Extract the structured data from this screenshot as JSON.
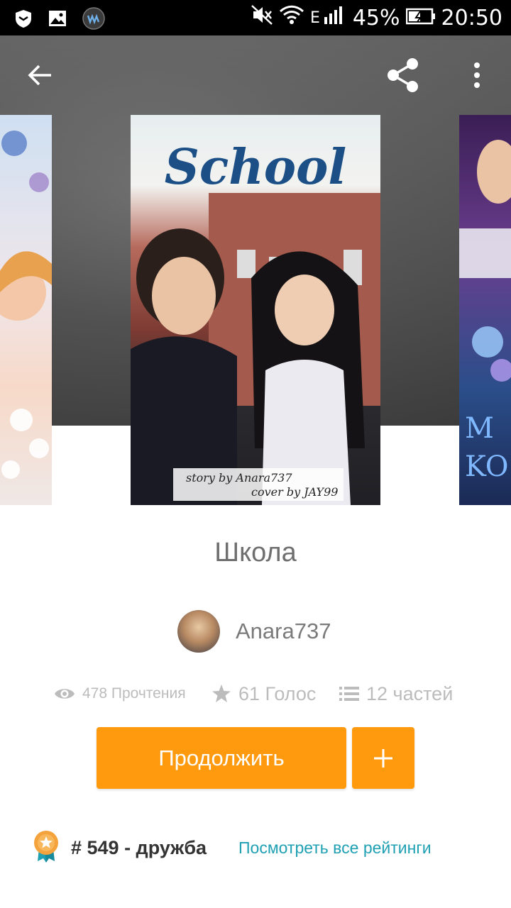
{
  "status_bar": {
    "battery": "45%",
    "time": "20:50"
  },
  "hero": {
    "center_cover": {
      "title": "School",
      "credit_story": "story by Anara737",
      "credit_cover": "cover by JAY99"
    },
    "right_cover_text": "M\nKO"
  },
  "story": {
    "title": "Школа",
    "author": "Anara737",
    "reads": "478 Прочтения",
    "votes": "61 Голос",
    "parts": "12 частей"
  },
  "actions": {
    "continue_label": "Продолжить",
    "add_label": "+"
  },
  "ranking": {
    "text": "# 549 - дружба",
    "link": "Посмотреть все рейтинги"
  },
  "colors": {
    "accent": "#ff9a0e",
    "link": "#1fa0b3"
  }
}
